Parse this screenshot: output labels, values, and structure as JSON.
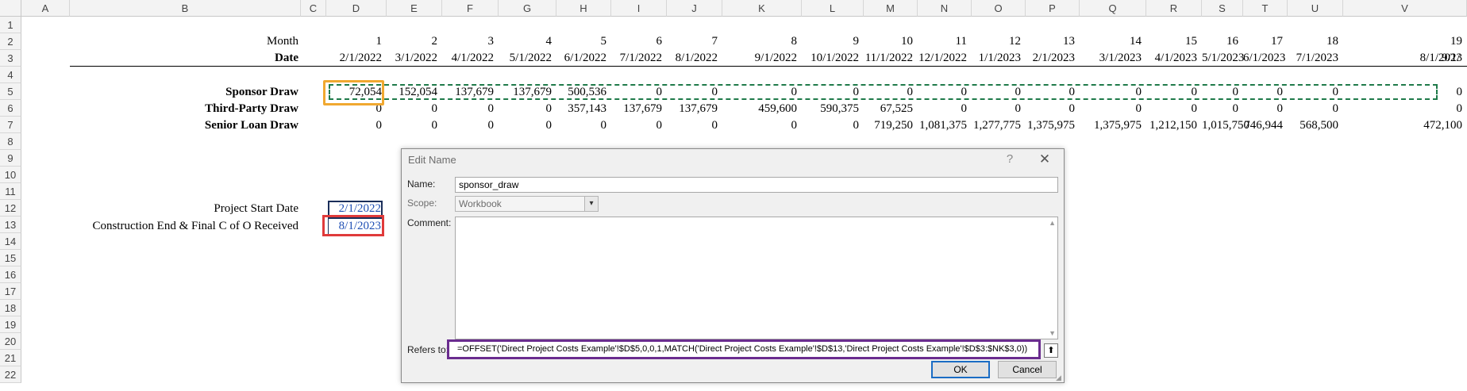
{
  "columns": [
    "A",
    "B",
    "C",
    "D",
    "E",
    "F",
    "G",
    "H",
    "I",
    "J",
    "K",
    "L",
    "M",
    "N",
    "O",
    "P",
    "Q",
    "R",
    "S",
    "T",
    "U",
    "V"
  ],
  "rows": [
    "1",
    "2",
    "3",
    "4",
    "5",
    "6",
    "7",
    "8",
    "9",
    "10",
    "11",
    "12",
    "13",
    "14",
    "15",
    "16",
    "17",
    "18",
    "19",
    "20",
    "21",
    "22"
  ],
  "labels": {
    "month": "Month",
    "date": "Date",
    "sponsor_draw": "Sponsor Draw",
    "third_party_draw": "Third-Party Draw",
    "senior_loan_draw": "Senior Loan Draw",
    "project_start_date": "Project Start Date",
    "construction_end": "Construction End & Final C of O Received"
  },
  "months": [
    "1",
    "2",
    "3",
    "4",
    "5",
    "6",
    "7",
    "8",
    "9",
    "10",
    "11",
    "12",
    "13",
    "14",
    "15",
    "16",
    "17",
    "18",
    "19"
  ],
  "dates": [
    "2/1/2022",
    "3/1/2022",
    "4/1/2022",
    "5/1/2022",
    "6/1/2022",
    "7/1/2022",
    "8/1/2022",
    "9/1/2022",
    "10/1/2022",
    "11/1/2022",
    "12/1/2022",
    "1/1/2023",
    "2/1/2023",
    "3/1/2023",
    "4/1/2023",
    "5/1/2023",
    "6/1/2023",
    "7/1/2023",
    "8/1/2023"
  ],
  "date_overflow": "9/1/",
  "sponsor_values": [
    "72,054",
    "152,054",
    "137,679",
    "137,679",
    "500,536",
    "0",
    "0",
    "0",
    "0",
    "0",
    "0",
    "0",
    "0",
    "0",
    "0",
    "0",
    "0",
    "0",
    "0"
  ],
  "third_party_values": [
    "0",
    "0",
    "0",
    "0",
    "357,143",
    "137,679",
    "137,679",
    "459,600",
    "590,375",
    "67,525",
    "0",
    "0",
    "0",
    "0",
    "0",
    "0",
    "0",
    "0",
    "0"
  ],
  "senior_loan_values": [
    "0",
    "0",
    "0",
    "0",
    "0",
    "0",
    "0",
    "0",
    "0",
    "719,250",
    "1,081,375",
    "1,277,775",
    "1,375,975",
    "1,375,975",
    "1,212,150",
    "1,015,750",
    "746,944",
    "568,500",
    "472,100"
  ],
  "project_start_date": "2/1/2022",
  "construction_end_date": "8/1/2023",
  "dialog": {
    "title": "Edit Name",
    "help": "?",
    "close": "✕",
    "name_label": "Name:",
    "name_value": "sponsor_draw",
    "scope_label": "Scope:",
    "scope_value": "Workbook",
    "comment_label": "Comment:",
    "refers_label": "Refers to:",
    "refers_value": "=OFFSET('Direct Project Costs Example'!$D$5,0,0,1,MATCH('Direct Project Costs Example'!$D$13,'Direct Project Costs Example'!$D$3:$NK$3,0))",
    "ok_label": "OK",
    "cancel_label": "Cancel"
  },
  "colors": {
    "orange": "#f0a830",
    "green_dash": "#1f7a4a",
    "red": "#e03a3a",
    "purple": "#6a2c8f",
    "date_blue": "#1f4fb4"
  }
}
